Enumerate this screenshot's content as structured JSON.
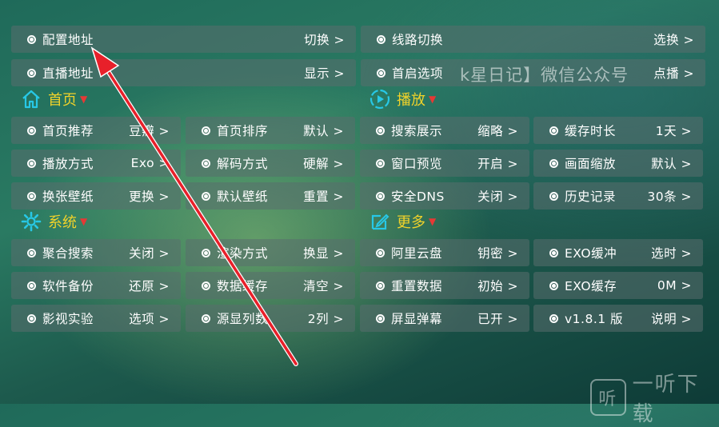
{
  "rows_top": [
    {
      "left": {
        "label": "配置地址",
        "value": "切换"
      },
      "right": {
        "label": "线路切换",
        "value": "选换"
      }
    },
    {
      "left": {
        "label": "直播地址",
        "value": "显示"
      },
      "right": {
        "label": "首启选项",
        "value": "点播"
      }
    }
  ],
  "section_home": {
    "title": "首页"
  },
  "section_play": {
    "title": "播放"
  },
  "grid_play": [
    [
      {
        "label": "首页推荐",
        "value": "豆瓣"
      },
      {
        "label": "首页排序",
        "value": "默认"
      },
      {
        "label": "搜索展示",
        "value": "缩略"
      },
      {
        "label": "缓存时长",
        "value": "1天"
      }
    ],
    [
      {
        "label": "播放方式",
        "value": "Exo"
      },
      {
        "label": "解码方式",
        "value": "硬解"
      },
      {
        "label": "窗口预览",
        "value": "开启"
      },
      {
        "label": "画面缩放",
        "value": "默认"
      }
    ],
    [
      {
        "label": "换张壁纸",
        "value": "更换"
      },
      {
        "label": "默认壁纸",
        "value": "重置"
      },
      {
        "label": "安全DNS",
        "value": "关闭"
      },
      {
        "label": "历史记录",
        "value": "30条"
      }
    ]
  ],
  "section_system": {
    "title": "系统"
  },
  "section_more": {
    "title": "更多"
  },
  "grid_system": [
    [
      {
        "label": "聚合搜索",
        "value": "关闭"
      },
      {
        "label": "渲染方式",
        "value": "换显"
      },
      {
        "label": "阿里云盘",
        "value": "钥密"
      },
      {
        "label": "EXO缓冲",
        "value": "选时"
      }
    ],
    [
      {
        "label": "软件备份",
        "value": "还原"
      },
      {
        "label": "数据缓存",
        "value": "清空"
      },
      {
        "label": "重置数据",
        "value": "初始"
      },
      {
        "label": "EXO缓存",
        "value": "0M"
      }
    ],
    [
      {
        "label": "影视实验",
        "value": "选项"
      },
      {
        "label": "源显列数",
        "value": "2列"
      },
      {
        "label": "屏显弹幕",
        "value": "已开"
      },
      {
        "label": "v1.8.1 版",
        "value": "说明"
      }
    ]
  ],
  "watermark_center": "k星日记】微信公众号",
  "watermark_corner": {
    "icon_glyph": "听",
    "text": "一听下载"
  },
  "colors": {
    "section_title": "#f0d22a",
    "section_icon": "#27c8e6",
    "arrow": "#e8202a"
  }
}
